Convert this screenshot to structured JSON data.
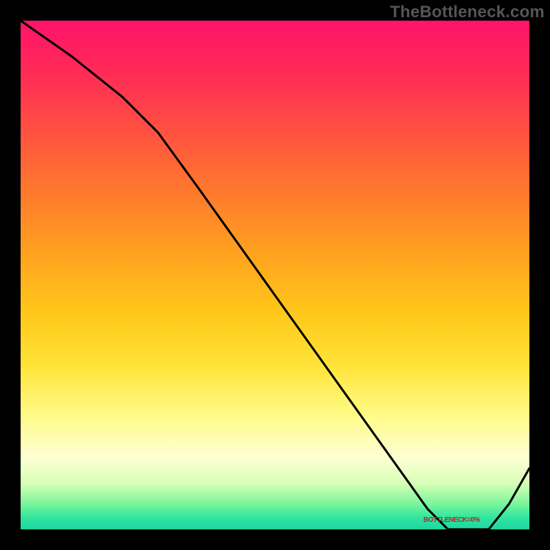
{
  "watermark": "TheBottleneck.com",
  "series_label": "BOTTLENECK=0%",
  "chart_data": {
    "type": "line",
    "title": "",
    "xlabel": "",
    "ylabel": "",
    "xlim": [
      0,
      100
    ],
    "ylim": [
      0,
      100
    ],
    "grid": false,
    "legend_position": "none",
    "background": {
      "type": "vertical-gradient",
      "stops": [
        {
          "pos": 0.0,
          "color": "#ff136b"
        },
        {
          "pos": 0.22,
          "color": "#ff5240"
        },
        {
          "pos": 0.46,
          "color": "#ffa31f"
        },
        {
          "pos": 0.68,
          "color": "#ffe43a"
        },
        {
          "pos": 0.86,
          "color": "#fdffd3"
        },
        {
          "pos": 0.95,
          "color": "#7af59b"
        },
        {
          "pos": 1.0,
          "color": "#1bd6a2"
        }
      ]
    },
    "series": [
      {
        "name": "bottleneck-curve",
        "color": "#000000",
        "x": [
          0,
          10,
          20,
          27,
          35,
          45,
          55,
          65,
          75,
          80,
          84,
          88,
          92,
          96,
          100
        ],
        "y": [
          100,
          93,
          85,
          78,
          67,
          53,
          39,
          25,
          11,
          4,
          0,
          0,
          0,
          5,
          12
        ]
      }
    ],
    "annotations": [
      {
        "text": "BOTTLENECK=0%",
        "x": 86,
        "y": 1,
        "color": "#b03030"
      }
    ]
  }
}
